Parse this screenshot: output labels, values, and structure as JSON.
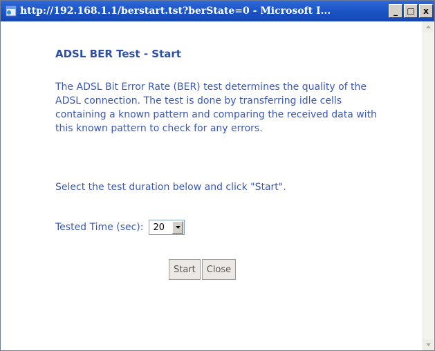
{
  "window": {
    "title": "http://192.168.1.1/berstart.tst?berState=0 - Microsoft I...",
    "buttons": {
      "minimize": "_",
      "maximize": "□",
      "close": "x"
    }
  },
  "page": {
    "heading": "ADSL BER Test - Start",
    "description": "The ADSL Bit Error Rate (BER) test determines the quality of the ADSL connection. The test is done by transferring idle cells containing a known pattern and comparing the received data with this known pattern to check for any errors.",
    "instruction": "Select the test duration below and click \"Start\".",
    "tested_time": {
      "label": "Tested Time (sec):",
      "selected": "20"
    },
    "start_label": "Start",
    "close_label": "Close"
  },
  "icons": {
    "window": "ie-page-icon",
    "dropdown": "chevron-down-icon",
    "scroll_up": "arrow-up-icon",
    "scroll_down": "arrow-down-icon"
  },
  "colors": {
    "titlebar": "#1d56c8",
    "text_blue": "#3a58b4",
    "heading_blue": "#2e4fa8"
  }
}
